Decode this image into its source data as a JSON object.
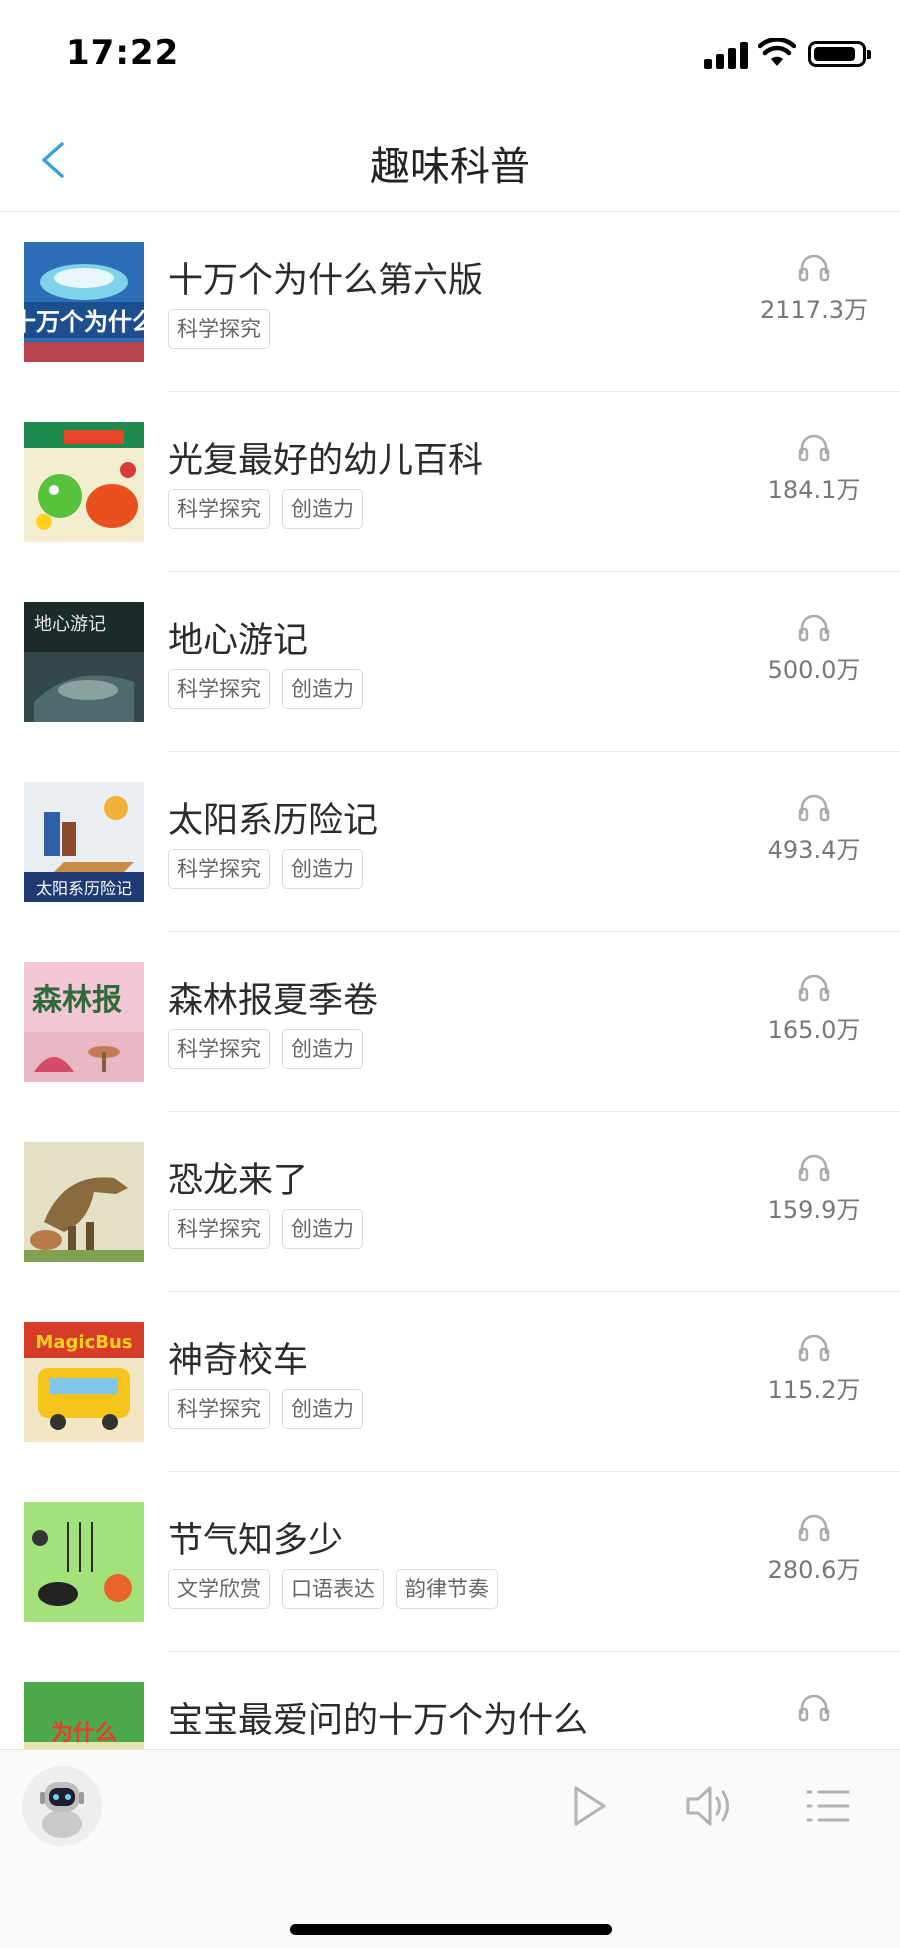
{
  "status_bar": {
    "time": "17:22",
    "battery_level": 0.9
  },
  "nav": {
    "title": "趣味科普",
    "back_icon": "chevron-left-icon",
    "accent_color": "#3a9fe0"
  },
  "items": [
    {
      "title": "十万个为什么第六版",
      "tags": [
        "科学探究"
      ],
      "plays": "2117.3万"
    },
    {
      "title": "光复最好的幼儿百科",
      "tags": [
        "科学探究",
        "创造力"
      ],
      "plays": "184.1万"
    },
    {
      "title": "地心游记",
      "tags": [
        "科学探究",
        "创造力"
      ],
      "plays": "500.0万"
    },
    {
      "title": "太阳系历险记",
      "tags": [
        "科学探究",
        "创造力"
      ],
      "plays": "493.4万"
    },
    {
      "title": "森林报夏季卷",
      "tags": [
        "科学探究",
        "创造力"
      ],
      "plays": "165.0万"
    },
    {
      "title": "恐龙来了",
      "tags": [
        "科学探究",
        "创造力"
      ],
      "plays": "159.9万"
    },
    {
      "title": "神奇校车",
      "tags": [
        "科学探究",
        "创造力"
      ],
      "plays": "115.2万"
    },
    {
      "title": "节气知多少",
      "tags": [
        "文学欣赏",
        "口语表达",
        "韵律节奏"
      ],
      "plays": "280.6万"
    },
    {
      "title": "宝宝最爱问的十万个为什么",
      "tags": [],
      "plays": ""
    }
  ],
  "player": {
    "avatar": "robot-avatar",
    "play_icon": "play-icon",
    "volume_icon": "volume-icon",
    "playlist_icon": "playlist-icon"
  }
}
